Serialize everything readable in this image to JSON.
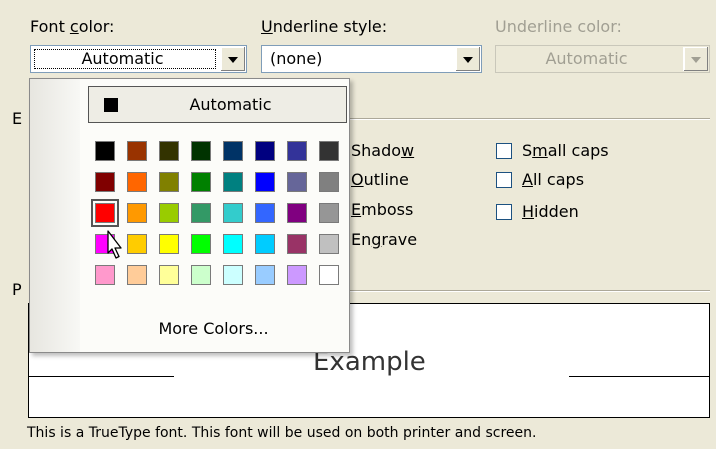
{
  "font_color": {
    "label": "Font color:",
    "value": "Automatic"
  },
  "underline_style": {
    "label": "Underline style:",
    "value": "(none)"
  },
  "underline_color": {
    "label": "Underline color:",
    "value": "Automatic"
  },
  "effects_letter": "E",
  "preview_letter": "P",
  "effects": {
    "shadow": "Shadow",
    "outline": "Outline",
    "emboss": "Emboss",
    "engrave": "Engrave",
    "small_caps": "Small caps",
    "all_caps": "All caps",
    "hidden": "Hidden"
  },
  "preview": {
    "text": "Example"
  },
  "info_text": "This is a TrueType font. This font will be used on both printer and screen.",
  "color_popup": {
    "automatic_label": "Automatic",
    "automatic_swatch": "#000000",
    "more_colors_label": "More Colors...",
    "selected_swatch": "#ff0000",
    "palette": [
      [
        "#000000",
        "#993300",
        "#333300",
        "#003300",
        "#003366",
        "#000080",
        "#333399",
        "#333333"
      ],
      [
        "#800000",
        "#ff6600",
        "#808000",
        "#008000",
        "#008080",
        "#0000ff",
        "#666699",
        "#808080"
      ],
      [
        "#ff0000",
        "#ff9900",
        "#99cc00",
        "#339966",
        "#33cccc",
        "#3366ff",
        "#800080",
        "#969696"
      ],
      [
        "#ff00ff",
        "#ffcc00",
        "#ffff00",
        "#00ff00",
        "#00ffff",
        "#00ccff",
        "#993366",
        "#c0c0c0"
      ],
      [
        "#ff99cc",
        "#ffcc99",
        "#ffff99",
        "#ccffcc",
        "#ccffff",
        "#99ccff",
        "#cc99ff",
        "#ffffff"
      ]
    ]
  }
}
